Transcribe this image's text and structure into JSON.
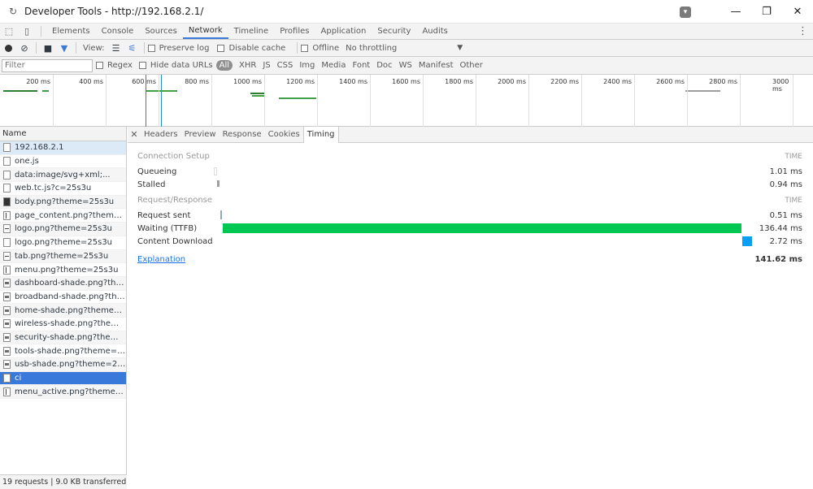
{
  "window": {
    "title": "Developer Tools - http://192.168.2.1/"
  },
  "panels": [
    "Elements",
    "Console",
    "Sources",
    "Network",
    "Timeline",
    "Profiles",
    "Application",
    "Security",
    "Audits"
  ],
  "active_panel": "Network",
  "toolbar": {
    "view_label": "View:",
    "preserve_log": "Preserve log",
    "disable_cache": "Disable cache",
    "offline": "Offline",
    "throttling": "No throttling"
  },
  "filter": {
    "placeholder": "Filter",
    "regex": "Regex",
    "hide_data_urls": "Hide data URLs",
    "types": [
      "All",
      "XHR",
      "JS",
      "CSS",
      "Img",
      "Media",
      "Font",
      "Doc",
      "WS",
      "Manifest",
      "Other"
    ],
    "active_type": "All"
  },
  "overview": {
    "ticks": [
      "200 ms",
      "400 ms",
      "600 ms",
      "800 ms",
      "1000 ms",
      "1200 ms",
      "1400 ms",
      "1600 ms",
      "1800 ms",
      "2000 ms",
      "2200 ms",
      "2400 ms",
      "2600 ms",
      "2800 ms",
      "3000 ms"
    ]
  },
  "requests": {
    "header": "Name",
    "items": [
      {
        "name": "192.168.2.1",
        "icon": "doc"
      },
      {
        "name": "one.js",
        "icon": "doc"
      },
      {
        "name": "data:image/svg+xml;...",
        "icon": "doc"
      },
      {
        "name": "web.tc.js?c=25s3u",
        "icon": "doc"
      },
      {
        "name": "body.png?theme=25s3u",
        "icon": "dark"
      },
      {
        "name": "page_content.png?theme=25s3u",
        "icon": "vbar"
      },
      {
        "name": "logo.png?theme=25s3u",
        "icon": "hbar"
      },
      {
        "name": "logo.png?theme=25s3u",
        "icon": "doc"
      },
      {
        "name": "tab.png?theme=25s3u",
        "icon": "hbar"
      },
      {
        "name": "menu.png?theme=25s3u",
        "icon": "vbar"
      },
      {
        "name": "dashboard-shade.png?theme=25s...",
        "icon": "img"
      },
      {
        "name": "broadband-shade.png?theme=25...",
        "icon": "img"
      },
      {
        "name": "home-shade.png?theme=25s3u",
        "icon": "img"
      },
      {
        "name": "wireless-shade.png?theme=25s3u",
        "icon": "img"
      },
      {
        "name": "security-shade.png?theme=25s3u",
        "icon": "img"
      },
      {
        "name": "tools-shade.png?theme=25s3u",
        "icon": "img"
      },
      {
        "name": "usb-shade.png?theme=25s3u",
        "icon": "img"
      },
      {
        "name": "ci",
        "icon": "doc"
      },
      {
        "name": "menu_active.png?theme=25s3u",
        "icon": "vbar"
      }
    ],
    "selected_index": 17,
    "status": "19 requests | 9.0 KB transferred | ..."
  },
  "detail": {
    "tabs": [
      "Headers",
      "Preview",
      "Response",
      "Cookies",
      "Timing"
    ],
    "active_tab": "Timing",
    "connection_setup": "Connection Setup",
    "request_response": "Request/Response",
    "time_header": "TIME",
    "rows": [
      {
        "label": "Queueing",
        "value": "1.01 ms"
      },
      {
        "label": "Stalled",
        "value": "0.94 ms"
      },
      {
        "label": "Request sent",
        "value": "0.51 ms"
      },
      {
        "label": "Waiting (TTFB)",
        "value": "136.44 ms"
      },
      {
        "label": "Content Download",
        "value": "2.72 ms"
      }
    ],
    "explanation": "Explanation",
    "total": "141.62 ms"
  },
  "colors": {
    "accent": "#3879d9",
    "ttfb": "#00c853",
    "download": "#0a9ff5",
    "queue": "#c8c8c8",
    "stalled": "#9e9e9e",
    "sent": "#8ea7c8"
  }
}
